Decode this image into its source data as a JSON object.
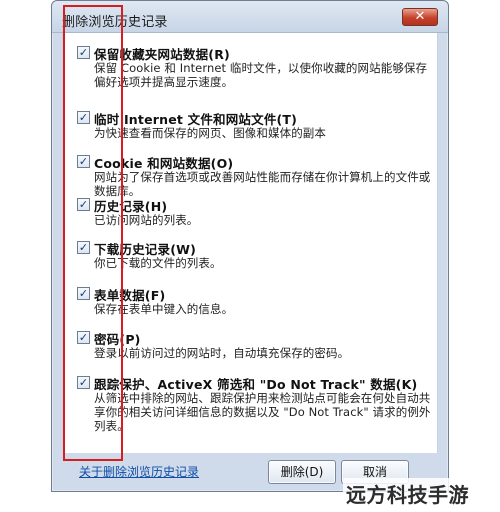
{
  "dialog": {
    "title": "删除浏览历史记录",
    "close_symbol": "✕"
  },
  "options": [
    {
      "title": "保留收藏夹网站数据(R)",
      "description": "保留 Cookie 和 Internet 临时文件，以使你收藏的网站能够保存偏好选项并提高显示速度。",
      "checked": true
    },
    {
      "title": "临时 Internet 文件和网站文件(T)",
      "description": "为快速查看而保存的网页、图像和媒体的副本",
      "checked": true
    },
    {
      "title": "Cookie 和网站数据(O)",
      "description": "网站为了保存首选项或改善网站性能而存储在你计算机上的文件或数据库。",
      "checked": true
    },
    {
      "title": "历史记录(H)",
      "description": "已访问网站的列表。",
      "checked": true
    },
    {
      "title": "下载历史记录(W)",
      "description": "你已下载的文件的列表。",
      "checked": true
    },
    {
      "title": "表单数据(F)",
      "description": "保存在表单中键入的信息。",
      "checked": true
    },
    {
      "title": "密码(P)",
      "description": "登录以前访问过的网站时，自动填充保存的密码。",
      "checked": true
    },
    {
      "title": "跟踪保护、ActiveX 筛选和 \"Do Not Track\" 数据(K)",
      "description": "从筛选中排除的网站、跟踪保护用来检测站点可能会在何处自动共享你的相关访问详细信息的数据以及 \"Do Not Track\" 请求的例外列表。",
      "checked": true
    }
  ],
  "footer": {
    "link_text": "关于删除浏览历史记录",
    "delete_label": "删除(D)",
    "cancel_label": "取消"
  },
  "watermark": "远方科技手游",
  "colors": {
    "highlight": "#d71d1d",
    "link": "#0f4da8"
  }
}
